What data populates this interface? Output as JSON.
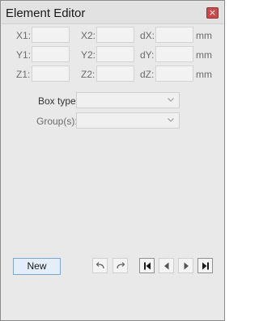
{
  "window": {
    "title": "Element Editor",
    "close_glyph": "×"
  },
  "coords": {
    "x1_label": "X1:",
    "y1_label": "Y1:",
    "z1_label": "Z1:",
    "x2_label": "X2:",
    "y2_label": "Y2:",
    "z2_label": "Z2:",
    "dx_label": "dX:",
    "dy_label": "dY:",
    "dz_label": "dZ:",
    "unit": "mm"
  },
  "form": {
    "box_type_label": "Box type:",
    "groups_label": "Group(s):",
    "box_type_value": "",
    "groups_value": ""
  },
  "buttons": {
    "new_label": "New"
  },
  "icons": {
    "undo": "undo-icon",
    "redo": "redo-icon",
    "first": "first-record-icon",
    "prev": "previous-record-icon",
    "next": "next-record-icon",
    "last": "last-record-icon",
    "chevron": "chevron-down-icon",
    "close": "close-icon"
  },
  "colors": {
    "close_button": "#c84a4a",
    "new_button_border": "#7fa6cf",
    "window_bg": "#e9e9e9"
  }
}
